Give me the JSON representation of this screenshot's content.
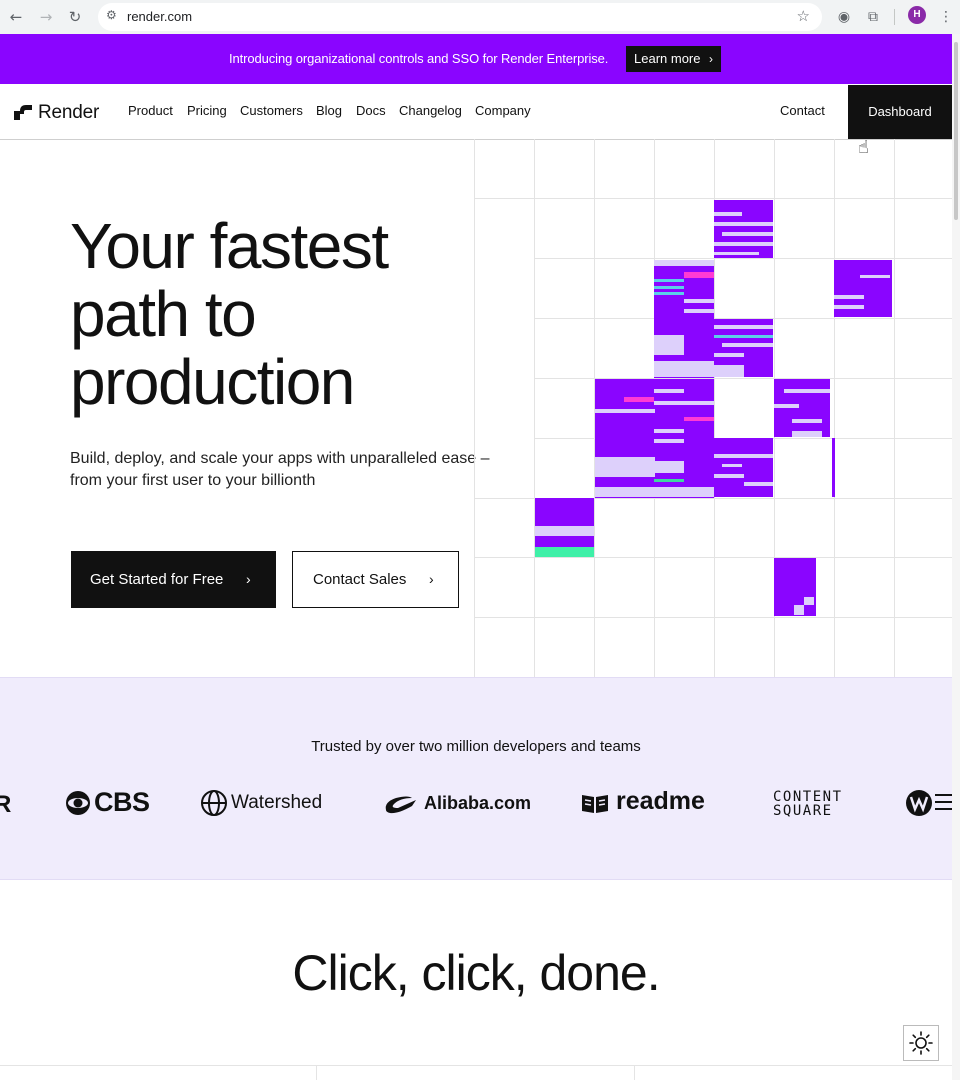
{
  "browser": {
    "url": "render.com",
    "profile_initial": "H"
  },
  "announcement": {
    "text": "Introducing organizational controls and SSO for Render Enterprise.",
    "cta": "Learn more",
    "cta_chevron": "›"
  },
  "nav": {
    "logo": "Render",
    "links": [
      "Product",
      "Pricing",
      "Customers",
      "Blog",
      "Docs",
      "Changelog",
      "Company"
    ],
    "contact": "Contact",
    "dashboard": "Dashboard"
  },
  "hero": {
    "title_lines": [
      "Your fastest",
      "path to",
      "production"
    ],
    "subtitle": "Build, deploy, and scale your apps with unparalleled ease – from your first user to your billionth",
    "primary_cta": "Get Started for Free",
    "secondary_cta": "Contact Sales",
    "chevron": "›"
  },
  "trusted": {
    "caption": "Trusted by over two million developers and teams",
    "logos": [
      "CBS",
      "Watershed",
      "Alibaba.com",
      "readme",
      "CONTENT",
      "SQUARE"
    ]
  },
  "section": {
    "title": "Click, click, done."
  },
  "colors": {
    "brand_purple": "#8a05ff",
    "light_purple": "#f0ecfc",
    "dark": "#111111"
  }
}
